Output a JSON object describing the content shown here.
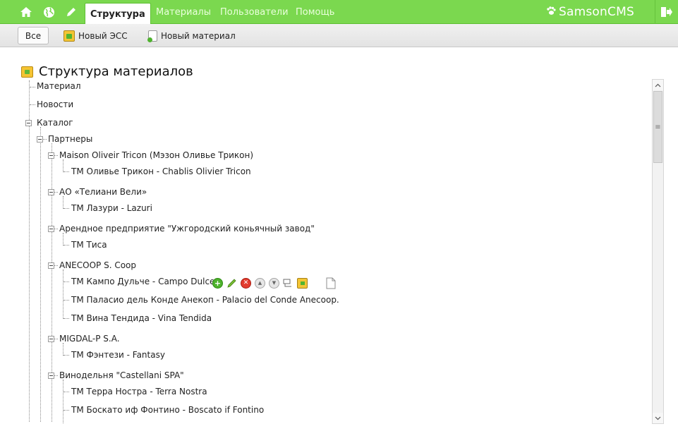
{
  "topbar": {
    "icons": [
      "home-icon",
      "globe-icon",
      "pencil-icon"
    ],
    "nav": [
      {
        "label": "Структура",
        "active": true
      },
      {
        "label": "Материалы",
        "active": false
      },
      {
        "label": "Пользователи",
        "active": false
      },
      {
        "label": "Помощь",
        "active": false
      }
    ],
    "brand": "SamsonCMS",
    "logout_icon": "logout-icon",
    "accent_color": "#7bd84f"
  },
  "toolbar": {
    "all_label": "Все",
    "new_ess_label": "Новый ЭСС",
    "new_material_label": "Новый материал"
  },
  "main": {
    "title": "Структура материалов",
    "tree": [
      {
        "label": "Материал"
      },
      {
        "label": "Новости"
      },
      {
        "label": "Каталог"
      },
      {
        "label": "Партнеры"
      },
      {
        "label": "Maison Oliveir Tricon (Мэзон Оливье Трикон)"
      },
      {
        "label": "ТМ Оливье Трикон - Chablis Olivier Tricon"
      },
      {
        "label": "АО «Телиани Вели»"
      },
      {
        "label": "ТМ Лазури - Lazuri"
      },
      {
        "label": "Арендное предприятие \"Ужгородский коньячный завод\""
      },
      {
        "label": "ТМ Тиса"
      },
      {
        "label": "ANECOOP S. Coop"
      },
      {
        "label": "ТМ Кампо Дульче - Campo Dulce"
      },
      {
        "label": "ТМ Паласио дель Конде Анекоп - Palacio del Conde Anecoop."
      },
      {
        "label": "ТМ Вина Тендида - Vina Tendida"
      },
      {
        "label": "MIGDAL-P S.A."
      },
      {
        "label": "ТМ Фэнтези - Fantasy"
      },
      {
        "label": "Винодельня \"Castellani SPA\""
      },
      {
        "label": "ТМ Терра Нострa - Terra Nostra"
      },
      {
        "label": "ТМ Боскато иф Фонтино - Boscato if Fontino"
      }
    ],
    "row_actions": [
      "add-icon",
      "edit-icon",
      "delete-icon",
      "move-up-icon",
      "move-down-icon",
      "structure-icon",
      "ess-icon",
      "page-icon"
    ]
  }
}
